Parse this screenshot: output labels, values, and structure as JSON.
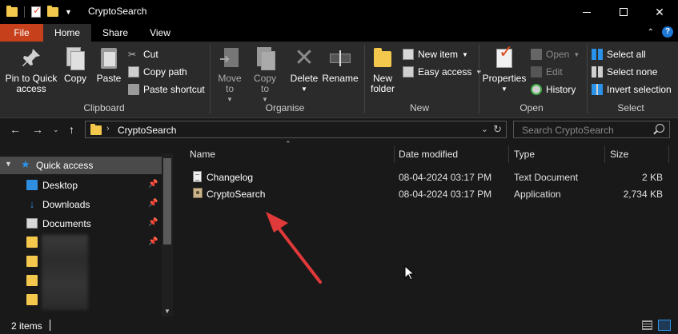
{
  "window": {
    "title": "CryptoSearch"
  },
  "ribbon_tabs": {
    "file": "File",
    "home": "Home",
    "share": "Share",
    "view": "View"
  },
  "ribbon": {
    "clipboard": {
      "label": "Clipboard",
      "pin": "Pin to Quick access",
      "copy": "Copy",
      "paste": "Paste",
      "cut": "Cut",
      "copy_path": "Copy path",
      "paste_shortcut": "Paste shortcut"
    },
    "organise": {
      "label": "Organise",
      "move_to": "Move to",
      "copy_to": "Copy to",
      "delete": "Delete",
      "rename": "Rename"
    },
    "new": {
      "label": "New",
      "new_folder": "New folder",
      "new_item": "New item",
      "easy_access": "Easy access"
    },
    "open": {
      "label": "Open",
      "properties": "Properties",
      "open": "Open",
      "edit": "Edit",
      "history": "History"
    },
    "select": {
      "label": "Select",
      "select_all": "Select all",
      "select_none": "Select none",
      "invert_selection": "Invert selection"
    }
  },
  "address": {
    "crumb": "CryptoSearch",
    "search_placeholder": "Search CryptoSearch"
  },
  "nav_pane": {
    "quick_access": "Quick access",
    "items": [
      {
        "label": "Desktop",
        "icon": "desktop-icon"
      },
      {
        "label": "Downloads",
        "icon": "downloads-icon"
      },
      {
        "label": "Documents",
        "icon": "documents-icon"
      }
    ]
  },
  "columns": {
    "name": "Name",
    "modified": "Date modified",
    "type": "Type",
    "size": "Size"
  },
  "files": [
    {
      "name": "Changelog",
      "modified": "08-04-2024 03:17 PM",
      "type": "Text Document",
      "size": "2 KB"
    },
    {
      "name": "CryptoSearch",
      "modified": "08-04-2024 03:17 PM",
      "type": "Application",
      "size": "2,734 KB"
    }
  ],
  "status": {
    "count": "2 items"
  },
  "colors": {
    "file_tab": "#c5401b",
    "annotation_arrow": "#e0393a",
    "accent": "#2a92e8"
  }
}
